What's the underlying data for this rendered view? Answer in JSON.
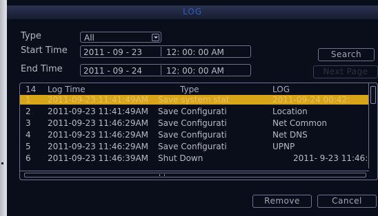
{
  "dialog": {
    "title": "LOG"
  },
  "filters": {
    "type_label": "Type",
    "type_value": "All",
    "start_label": "Start Time",
    "start_date": "2011 - 09 - 23",
    "start_time": "12: 00: 00  AM",
    "end_label": "End Time",
    "end_date": "2011 - 09 - 24",
    "end_time": "12: 00: 00  AM"
  },
  "buttons": {
    "search": "Search",
    "next_page": "Next Page",
    "remove": "Remove",
    "cancel": "Cancel"
  },
  "table": {
    "headers": {
      "count": "14",
      "time": "Log Time",
      "type": "Type",
      "log": "LOG"
    },
    "rows": [
      {
        "idx": "1",
        "time": "2011-09-23 11:41:49AM",
        "type": "Save system stat",
        "log": "2011-09-24 00:42:"
      },
      {
        "idx": "2",
        "time": "2011-09-23 11:41:49AM",
        "type": "Save Configurati",
        "log": "Location"
      },
      {
        "idx": "3",
        "time": "2011-09-23 11:46:29AM",
        "type": "Save Configurati",
        "log": "Net Common"
      },
      {
        "idx": "4",
        "time": "2011-09-23 11:46:29AM",
        "type": "Save Configurati",
        "log": "Net DNS"
      },
      {
        "idx": "5",
        "time": "2011-09-23 11:46:29AM",
        "type": "Save Configurati",
        "log": "UPNP"
      },
      {
        "idx": "6",
        "time": "2011-09-23 11:46:39AM",
        "type": "Shut Down",
        "log": "2011- 9-23 11:46:"
      }
    ]
  },
  "colors": {
    "background": "#0a0e1a",
    "selected_row": "#d8a51a",
    "title": "#2f5dc8",
    "text": "#b7bac9"
  }
}
